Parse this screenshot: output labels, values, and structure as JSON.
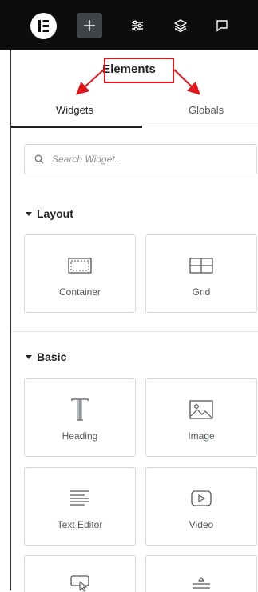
{
  "topbar": {
    "logo_icon": "elementor-logo-icon",
    "buttons": [
      "add-element-icon",
      "site-settings-icon",
      "structure-icon",
      "notes-icon"
    ]
  },
  "panel": {
    "title": "Elements"
  },
  "tabs": [
    {
      "label": "Widgets",
      "active": true
    },
    {
      "label": "Globals",
      "active": false
    }
  ],
  "search": {
    "placeholder": "Search Widget..."
  },
  "sections": {
    "layout": {
      "title": "Layout",
      "widgets": [
        {
          "label": "Container",
          "icon": "container-icon"
        },
        {
          "label": "Grid",
          "icon": "grid-icon"
        }
      ]
    },
    "basic": {
      "title": "Basic",
      "widgets": [
        {
          "label": "Heading",
          "icon": "heading-icon"
        },
        {
          "label": "Image",
          "icon": "image-icon"
        },
        {
          "label": "Text Editor",
          "icon": "text-editor-icon"
        },
        {
          "label": "Video",
          "icon": "video-icon"
        },
        {
          "label": "",
          "icon": "button-icon"
        },
        {
          "label": "",
          "icon": "divider-icon"
        }
      ]
    }
  },
  "colors": {
    "topbar_bg": "#0c0d0e",
    "annotation_red": "#e3131a",
    "text_dark": "#1f2124",
    "text_muted": "#51575d"
  }
}
